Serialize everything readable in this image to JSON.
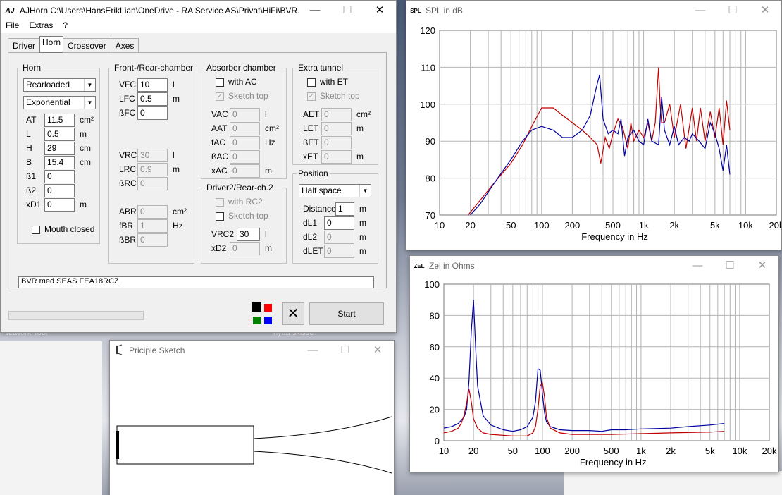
{
  "desktop": {
    "labels": [
      "Network Tool",
      "hytta skisse"
    ]
  },
  "main_window": {
    "icon": "AJ",
    "title": "AJHorn  C:\\Users\\HansErikLian\\OneDrive - RA Service AS\\Privat\\HiFi\\BVR...",
    "menu": [
      "File",
      "Extras",
      "?"
    ],
    "tabs": [
      "Driver",
      "Horn",
      "Crossover",
      "Axes"
    ],
    "selected_tab": "Horn",
    "horn": {
      "label": "Horn",
      "loading": "Rearloaded",
      "flare": "Exponential",
      "params": [
        {
          "name": "AT",
          "value": "11.5",
          "unit": "cm²"
        },
        {
          "name": "L",
          "value": "0.5",
          "unit": "m"
        },
        {
          "name": "H",
          "value": "29",
          "unit": "cm"
        },
        {
          "name": "B",
          "value": "15.4",
          "unit": "cm"
        },
        {
          "name": "ß1",
          "value": "0",
          "unit": ""
        },
        {
          "name": "ß2",
          "value": "0",
          "unit": ""
        },
        {
          "name": "xD1",
          "value": "0",
          "unit": "m"
        }
      ],
      "mouth_closed": "Mouth closed"
    },
    "front_rear": {
      "label": "Front-/Rear-chamber",
      "front": [
        {
          "name": "VFC",
          "value": "10",
          "unit": "l"
        },
        {
          "name": "LFC",
          "value": "0.5",
          "unit": "m"
        },
        {
          "name": "ßFC",
          "value": "0",
          "unit": ""
        }
      ],
      "rear": [
        {
          "name": "VRC",
          "value": "30",
          "unit": "l"
        },
        {
          "name": "LRC",
          "value": "0.9",
          "unit": "m"
        },
        {
          "name": "ßRC",
          "value": "0",
          "unit": ""
        }
      ],
      "br": [
        {
          "name": "ABR",
          "value": "0",
          "unit": "cm²"
        },
        {
          "name": "fBR",
          "value": "1",
          "unit": "Hz"
        },
        {
          "name": "ßBR",
          "value": "0",
          "unit": ""
        }
      ]
    },
    "absorber": {
      "label": "Absorber chamber",
      "with": "with AC",
      "sketch": "Sketch top",
      "params": [
        {
          "name": "VAC",
          "value": "0",
          "unit": "l"
        },
        {
          "name": "AAT",
          "value": "0",
          "unit": "cm²"
        },
        {
          "name": "fAC",
          "value": "0",
          "unit": "Hz"
        },
        {
          "name": "ßAC",
          "value": "0",
          "unit": ""
        },
        {
          "name": "xAC",
          "value": "0",
          "unit": "m"
        }
      ]
    },
    "driver2": {
      "label": "Driver2/Rear-ch.2",
      "with": "with RC2",
      "sketch": "Sketch top",
      "params": [
        {
          "name": "VRC2",
          "value": "30",
          "unit": "l"
        },
        {
          "name": "xD2",
          "value": "0",
          "unit": "m"
        }
      ]
    },
    "extra_tunnel": {
      "label": "Extra tunnel",
      "with": "with ET",
      "sketch": "Sketch top",
      "params": [
        {
          "name": "AET",
          "value": "0",
          "unit": "cm²"
        },
        {
          "name": "LET",
          "value": "0",
          "unit": "m"
        },
        {
          "name": "ßET",
          "value": "0",
          "unit": ""
        },
        {
          "name": "xET",
          "value": "0",
          "unit": "m"
        }
      ]
    },
    "position": {
      "label": "Position",
      "space": "Half space",
      "params": [
        {
          "name": "Distance",
          "value": "1",
          "unit": "m"
        },
        {
          "name": "dL1",
          "value": "0",
          "unit": "m"
        },
        {
          "name": "dL2",
          "value": "0",
          "unit": "m"
        },
        {
          "name": "dLET",
          "value": "0",
          "unit": "m"
        }
      ]
    },
    "description": "BVR med SEAS FEA18RCZ",
    "swatches": [
      "#000000",
      "#ff0000",
      "#008000",
      "#0000ff"
    ],
    "clear_icon": "close-x-icon",
    "start_label": "Start"
  },
  "sketch_window": {
    "title": "Priciple Sketch"
  },
  "spl_window": {
    "badge": "SPL",
    "title": "SPL in dB"
  },
  "zel_window": {
    "badge": "ZEL",
    "title": "Zel in Ohms"
  },
  "chart_data": [
    {
      "type": "line",
      "title": "SPL in dB",
      "xlabel": "Frequency in Hz",
      "ylabel": "",
      "xscale": "log",
      "xlim": [
        10,
        20000
      ],
      "ylim": [
        70,
        120
      ],
      "xticks": [
        "10",
        "20",
        "50",
        "100",
        "200",
        "500",
        "1k",
        "2k",
        "5k",
        "10k",
        "20k"
      ],
      "yticks": [
        "70",
        "80",
        "90",
        "100",
        "110",
        "120"
      ],
      "grid": true,
      "series": [
        {
          "color": "#c00000",
          "x": [
            19,
            25,
            35,
            50,
            65,
            80,
            100,
            130,
            160,
            200,
            250,
            300,
            350,
            380,
            420,
            460,
            500,
            560,
            620,
            700,
            750,
            800,
            900,
            1000,
            1100,
            1200,
            1300,
            1400,
            1450,
            1500,
            1600,
            1800,
            2000,
            2300,
            2600,
            3000,
            3300,
            3600,
            4000,
            4500,
            5000,
            5500,
            6000,
            6500,
            7000
          ],
          "y": [
            70,
            74,
            79,
            84,
            89,
            94,
            99,
            99,
            97,
            95,
            93,
            91,
            89,
            84,
            91,
            88,
            92,
            96,
            94,
            88,
            95,
            90,
            93,
            91,
            95,
            90,
            95,
            110,
            100,
            95,
            95,
            100,
            91,
            100,
            88,
            99,
            90,
            99,
            90,
            98,
            91,
            99,
            89,
            101,
            93
          ]
        },
        {
          "color": "#0000a0",
          "x": [
            20,
            25,
            35,
            50,
            65,
            80,
            100,
            130,
            160,
            200,
            250,
            300,
            340,
            370,
            400,
            450,
            500,
            560,
            600,
            650,
            700,
            800,
            900,
            1000,
            1100,
            1200,
            1400,
            1500,
            1600,
            1800,
            2000,
            2200,
            2500,
            2800,
            3000,
            3500,
            4000,
            4500,
            5000,
            5500,
            6000,
            6500,
            7000
          ],
          "y": [
            70,
            73,
            79,
            85,
            90,
            93,
            94,
            93,
            91,
            91,
            93,
            97,
            104,
            108,
            96,
            92,
            93,
            92,
            96,
            86,
            91,
            93,
            90,
            89,
            96,
            90,
            89,
            102,
            93,
            89,
            94,
            89,
            91,
            90,
            92,
            90,
            88,
            95,
            92,
            88,
            82,
            89,
            81
          ]
        }
      ]
    },
    {
      "type": "line",
      "title": "Zel in Ohms",
      "xlabel": "Frequency in Hz",
      "ylabel": "",
      "xscale": "log",
      "xlim": [
        10,
        20000
      ],
      "ylim": [
        0,
        100
      ],
      "xticks": [
        "10",
        "20",
        "50",
        "100",
        "200",
        "500",
        "1k",
        "2k",
        "5k",
        "10k",
        "20k"
      ],
      "yticks": [
        "0",
        "20",
        "40",
        "60",
        "80",
        "100"
      ],
      "grid": true,
      "series": [
        {
          "color": "#0000a0",
          "x": [
            10,
            12,
            14,
            16,
            17,
            18,
            19,
            20,
            21,
            22,
            25,
            30,
            40,
            50,
            60,
            70,
            80,
            85,
            90,
            95,
            100,
            105,
            110,
            120,
            150,
            200,
            300,
            400,
            500,
            700,
            1000,
            2000,
            3000,
            5000,
            7000
          ],
          "y": [
            8,
            9,
            11,
            15,
            20,
            38,
            70,
            90,
            60,
            35,
            16,
            10,
            7,
            6,
            7,
            9,
            15,
            25,
            46,
            45,
            30,
            18,
            12,
            9,
            7,
            6.5,
            6.5,
            6,
            7,
            7,
            7.5,
            8,
            9,
            10,
            11
          ]
        },
        {
          "color": "#c00000",
          "x": [
            10,
            12,
            14,
            15,
            16,
            17,
            18,
            19,
            20,
            22,
            25,
            30,
            50,
            70,
            80,
            85,
            90,
            95,
            100,
            105,
            110,
            120,
            150,
            200,
            500,
            1000,
            2000,
            5000,
            7000
          ],
          "y": [
            5,
            6,
            8,
            11,
            16,
            24,
            33,
            25,
            14,
            8,
            5,
            4,
            3,
            3,
            5,
            9,
            20,
            35,
            37,
            28,
            15,
            8,
            5,
            4,
            4,
            4.5,
            5,
            5.5,
            6
          ]
        }
      ]
    }
  ]
}
